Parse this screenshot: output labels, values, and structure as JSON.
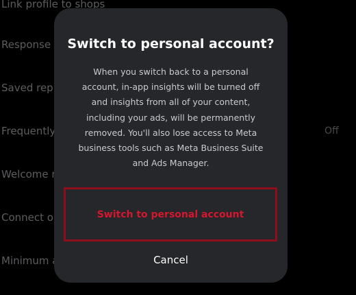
{
  "background_settings": {
    "rows": [
      {
        "label": "Link profile to shops",
        "value": ""
      },
      {
        "label": "Response se",
        "value": ""
      },
      {
        "label": "Saved repli",
        "value": ""
      },
      {
        "label": "Frequently",
        "value": "Off"
      },
      {
        "label": "Welcome me",
        "value": ""
      },
      {
        "label": "Connect or",
        "value": ""
      },
      {
        "label": "Minimum ag",
        "value": ""
      }
    ]
  },
  "dialog": {
    "title": "Switch to personal account?",
    "message": "When you switch back to a personal account, in-app insights will be turned off and insights from all of your content, including your ads, will be permanently removed. You'll also lose access to Meta business tools such as Meta Business Suite and Ads Manager.",
    "confirm_label": "Switch to personal account",
    "cancel_label": "Cancel"
  },
  "colors": {
    "dialog_background": "#25272b",
    "confirm_text": "#d4172d",
    "confirm_border": "#900d1c"
  }
}
